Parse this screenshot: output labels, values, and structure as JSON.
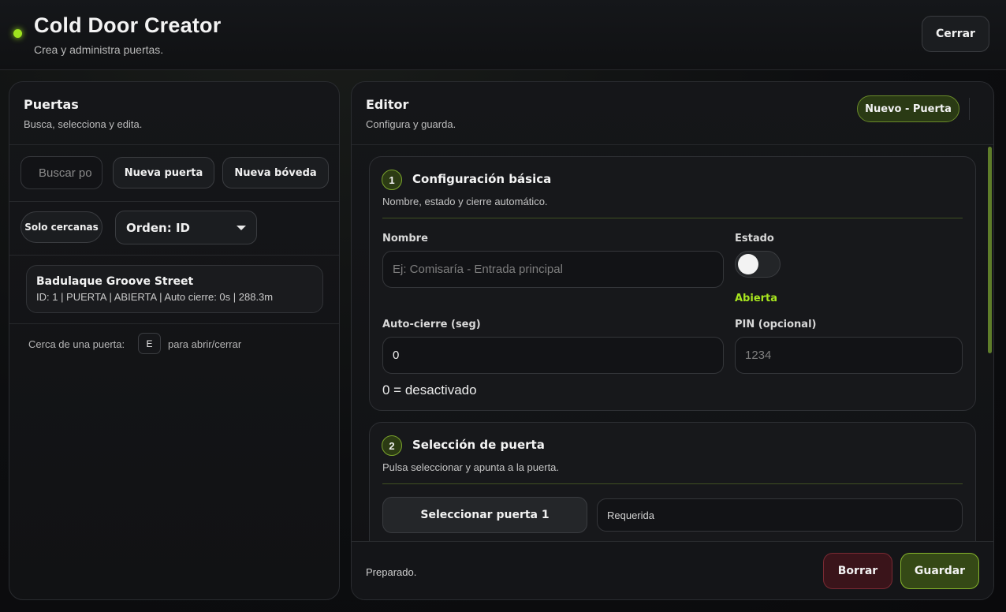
{
  "header": {
    "title": "Cold Door Creator",
    "subtitle": "Crea y administra puertas.",
    "close_label": "Cerrar",
    "status_color": "#9fe31f"
  },
  "left_panel": {
    "title": "Puertas",
    "subtitle": "Busca, selecciona y edita.",
    "search_placeholder": "Buscar po",
    "new_door_label": "Nueva puerta",
    "new_vault_label": "Nueva bóveda",
    "nearby_label": "Solo cercanas",
    "order_label": "Orden: ID",
    "doors": [
      {
        "name": "Badulaque Groove Street",
        "meta": "ID: 1 | PUERTA | ABIERTA | Auto cierre: 0s | 288.3m"
      }
    ],
    "hint_prefix": "Cerca de una puerta:",
    "hint_key": "E",
    "hint_suffix": "para abrir/cerrar"
  },
  "editor": {
    "title": "Editor",
    "subtitle": "Configura y guarda.",
    "mode_badge": "Nuevo - Puerta",
    "section1": {
      "number": "1",
      "title": "Configuración básica",
      "subtitle": "Nombre, estado y cierre automático.",
      "name_label": "Nombre",
      "name_placeholder": "Ej: Comisaría - Entrada principal",
      "state_label": "Estado",
      "state_value": "Abierta",
      "autoclose_label": "Auto-cierre (seg)",
      "autoclose_value": "0",
      "autoclose_help": "0 = desactivado",
      "pin_label": "PIN (opcional)",
      "pin_placeholder": "1234"
    },
    "section2": {
      "number": "2",
      "title": "Selección de puerta",
      "subtitle": "Pulsa seleccionar y apunta a la puerta.",
      "select_button": "Seleccionar puerta 1",
      "required_text": "Requerida"
    },
    "footer": {
      "status": "Preparado.",
      "delete_label": "Borrar",
      "save_label": "Guardar"
    }
  },
  "colors": {
    "accent": "#9fe31f",
    "danger": "#3a141a",
    "primary": "#354916"
  }
}
